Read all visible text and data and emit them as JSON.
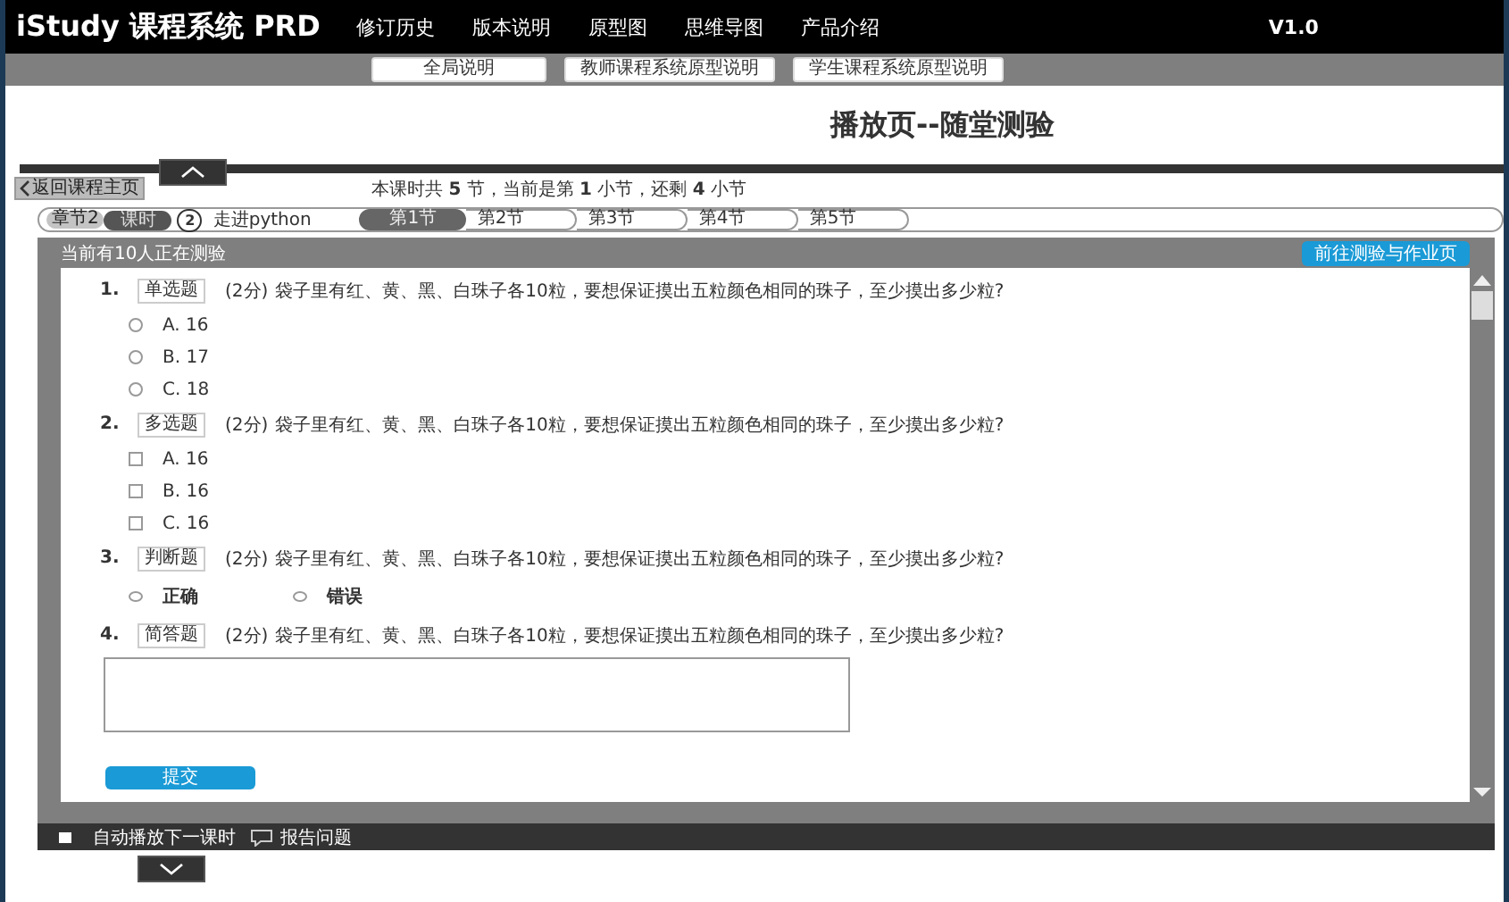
{
  "header": {
    "title": "iStudy 课程系统 PRD",
    "nav": [
      {
        "label": "修订历史"
      },
      {
        "label": "版本说明"
      },
      {
        "label": "原型图"
      },
      {
        "label": "思维导图"
      },
      {
        "label": "产品介绍"
      }
    ],
    "version": "V1.0"
  },
  "subnav": [
    {
      "label": "全局说明"
    },
    {
      "label": "教师课程系统原型说明"
    },
    {
      "label": "学生课程系统原型说明"
    }
  ],
  "page_title": "播放页--随堂测验",
  "back_button": "返回课程主页",
  "lesson_info": "本课时共 **5** 节，当前是第 **1** 小节，还剩 **4** 小节",
  "breadcrumb": {
    "chapter": "章节2",
    "lesson": "课时",
    "number": "2",
    "name": "走进python"
  },
  "sections": [
    {
      "label": "第1节",
      "selected": true
    },
    {
      "label": "第2节",
      "selected": false
    },
    {
      "label": "第3节",
      "selected": false
    },
    {
      "label": "第4节",
      "selected": false
    },
    {
      "label": "第5节",
      "selected": false
    }
  ],
  "panel": {
    "status": "当前有10人正在测验",
    "goto_button": "前往测验与作业页"
  },
  "questions": [
    {
      "number": "1.",
      "type": "单选题",
      "kind": "radio",
      "score": "(2分)",
      "text": "袋子里有红、黄、黑、白珠子各10粒，要想保证摸出五粒颜色相同的珠子，至少摸出多少粒?",
      "options": [
        {
          "label": "A.  16",
          "checked": false
        },
        {
          "label": "B.  17",
          "checked": false
        },
        {
          "label": "C.  18",
          "checked": false
        }
      ]
    },
    {
      "number": "2.",
      "type": "多选题",
      "kind": "checkbox",
      "score": "(2分)",
      "text": "袋子里有红、黄、黑、白珠子各10粒，要想保证摸出五粒颜色相同的珠子，至少摸出多少粒?",
      "options": [
        {
          "label": "A.  16",
          "checked": false
        },
        {
          "label": "B.  16",
          "checked": false
        },
        {
          "label": "C.  16",
          "checked": false
        }
      ]
    },
    {
      "number": "3.",
      "type": "判断题",
      "kind": "truefalse",
      "score": "(2分)",
      "text": "袋子里有红、黄、黑、白珠子各10粒，要想保证摸出五粒颜色相同的珠子，至少摸出多少粒?",
      "options": [
        {
          "label": "正确",
          "checked": false
        },
        {
          "label": "错误",
          "checked": false
        }
      ]
    },
    {
      "number": "4.",
      "type": "简答题",
      "kind": "text",
      "score": "(2分)",
      "text": "袋子里有红、黄、黑、白珠子各10粒，要想保证摸出五粒颜色相同的珠子，至少摸出多少粒?"
    }
  ],
  "submit_button": "提交",
  "footer": {
    "autoplay": {
      "label": "自动播放下一课时",
      "checked": false
    },
    "report": "报告问题"
  }
}
